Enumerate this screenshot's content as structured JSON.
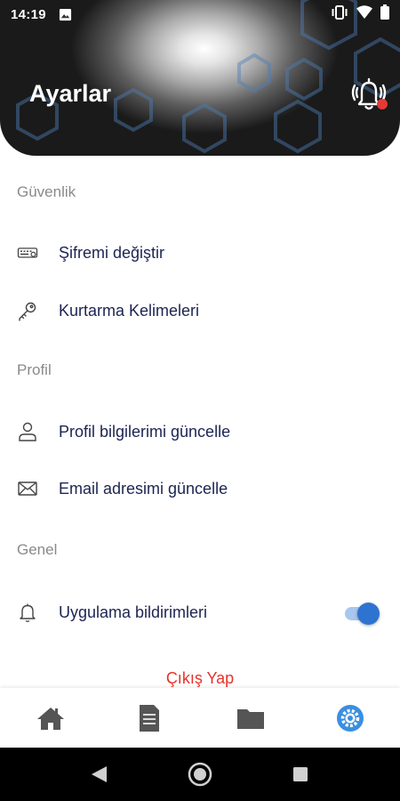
{
  "status_bar": {
    "time": "14:19",
    "icons": [
      "image-icon",
      "vibrate-icon",
      "wifi-icon",
      "battery-icon"
    ]
  },
  "header": {
    "title": "Ayarlar",
    "notification_icon": "bell-ringing-icon",
    "badge_color": "#e53935"
  },
  "sections": {
    "security": {
      "title": "Güvenlik",
      "items": [
        {
          "label": "Şifremi değiştir",
          "icon": "keyboard-password-icon"
        },
        {
          "label": "Kurtarma Kelimeleri",
          "icon": "key-icon"
        }
      ]
    },
    "profile": {
      "title": "Profil",
      "items": [
        {
          "label": "Profil bilgilerimi güncelle",
          "icon": "user-icon"
        },
        {
          "label": "Email adresimi güncelle",
          "icon": "mail-icon"
        }
      ]
    },
    "general": {
      "title": "Genel",
      "items": [
        {
          "label": "Uygulama bildirimleri",
          "icon": "bell-icon",
          "toggle_on": true
        }
      ]
    }
  },
  "logout_label": "Çıkış Yap",
  "bottom_nav": {
    "items": [
      {
        "icon": "home-icon",
        "active": false
      },
      {
        "icon": "document-icon",
        "active": false
      },
      {
        "icon": "folder-icon",
        "active": false
      },
      {
        "icon": "settings-icon",
        "active": true
      }
    ],
    "active_color": "#3a8fe0",
    "inactive_color": "#555555"
  },
  "colors": {
    "label_text": "#1c2452",
    "section_title": "#8a8a8a",
    "logout": "#e5332a",
    "toggle_track": "#a7c6f0",
    "toggle_knob": "#2f73d0"
  }
}
